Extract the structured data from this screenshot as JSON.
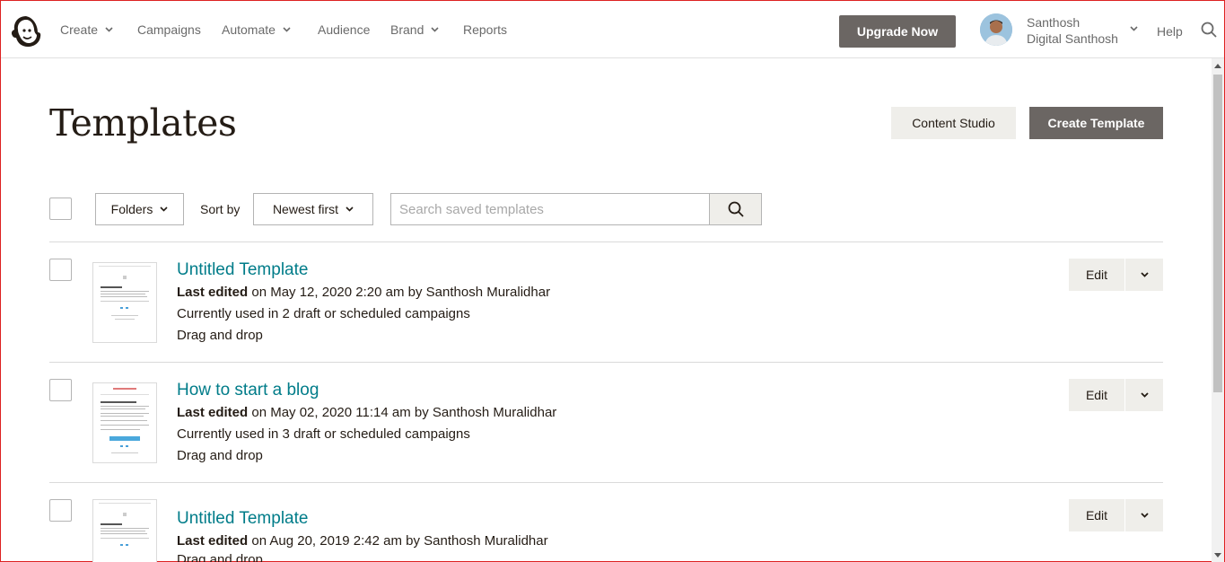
{
  "nav": {
    "create": "Create",
    "campaigns": "Campaigns",
    "automate": "Automate",
    "audience": "Audience",
    "brand": "Brand",
    "reports": "Reports",
    "upgrade": "Upgrade Now",
    "user_name": "Santhosh",
    "user_org": "Digital Santhosh",
    "help": "Help"
  },
  "header": {
    "title": "Templates",
    "content_studio": "Content Studio",
    "create_template": "Create Template"
  },
  "toolbar": {
    "folders": "Folders",
    "sort_label": "Sort by",
    "sort_value": "Newest first",
    "search_placeholder": "Search saved templates"
  },
  "templates": [
    {
      "title": "Untitled Template",
      "edited_label": "Last edited",
      "edited_rest": "on May 12, 2020 2:20 am by Santhosh Muralidhar",
      "usage": "Currently used in 2 draft or scheduled campaigns",
      "type": "Drag and drop",
      "edit": "Edit"
    },
    {
      "title": "How to start a blog",
      "edited_label": "Last edited",
      "edited_rest": "on May 02, 2020 11:14 am by Santhosh Muralidhar",
      "usage": "Currently used in 3 draft or scheduled campaigns",
      "type": "Drag and drop",
      "edit": "Edit"
    },
    {
      "title": "Untitled Template",
      "edited_label": "Last edited",
      "edited_rest": "on Aug 20, 2019 2:42 am by Santhosh Muralidhar",
      "type": "Drag and drop",
      "edit": "Edit"
    }
  ],
  "colors": {
    "accent": "#007c89",
    "primary_button": "#6b6663",
    "secondary_button": "#efeeea"
  }
}
